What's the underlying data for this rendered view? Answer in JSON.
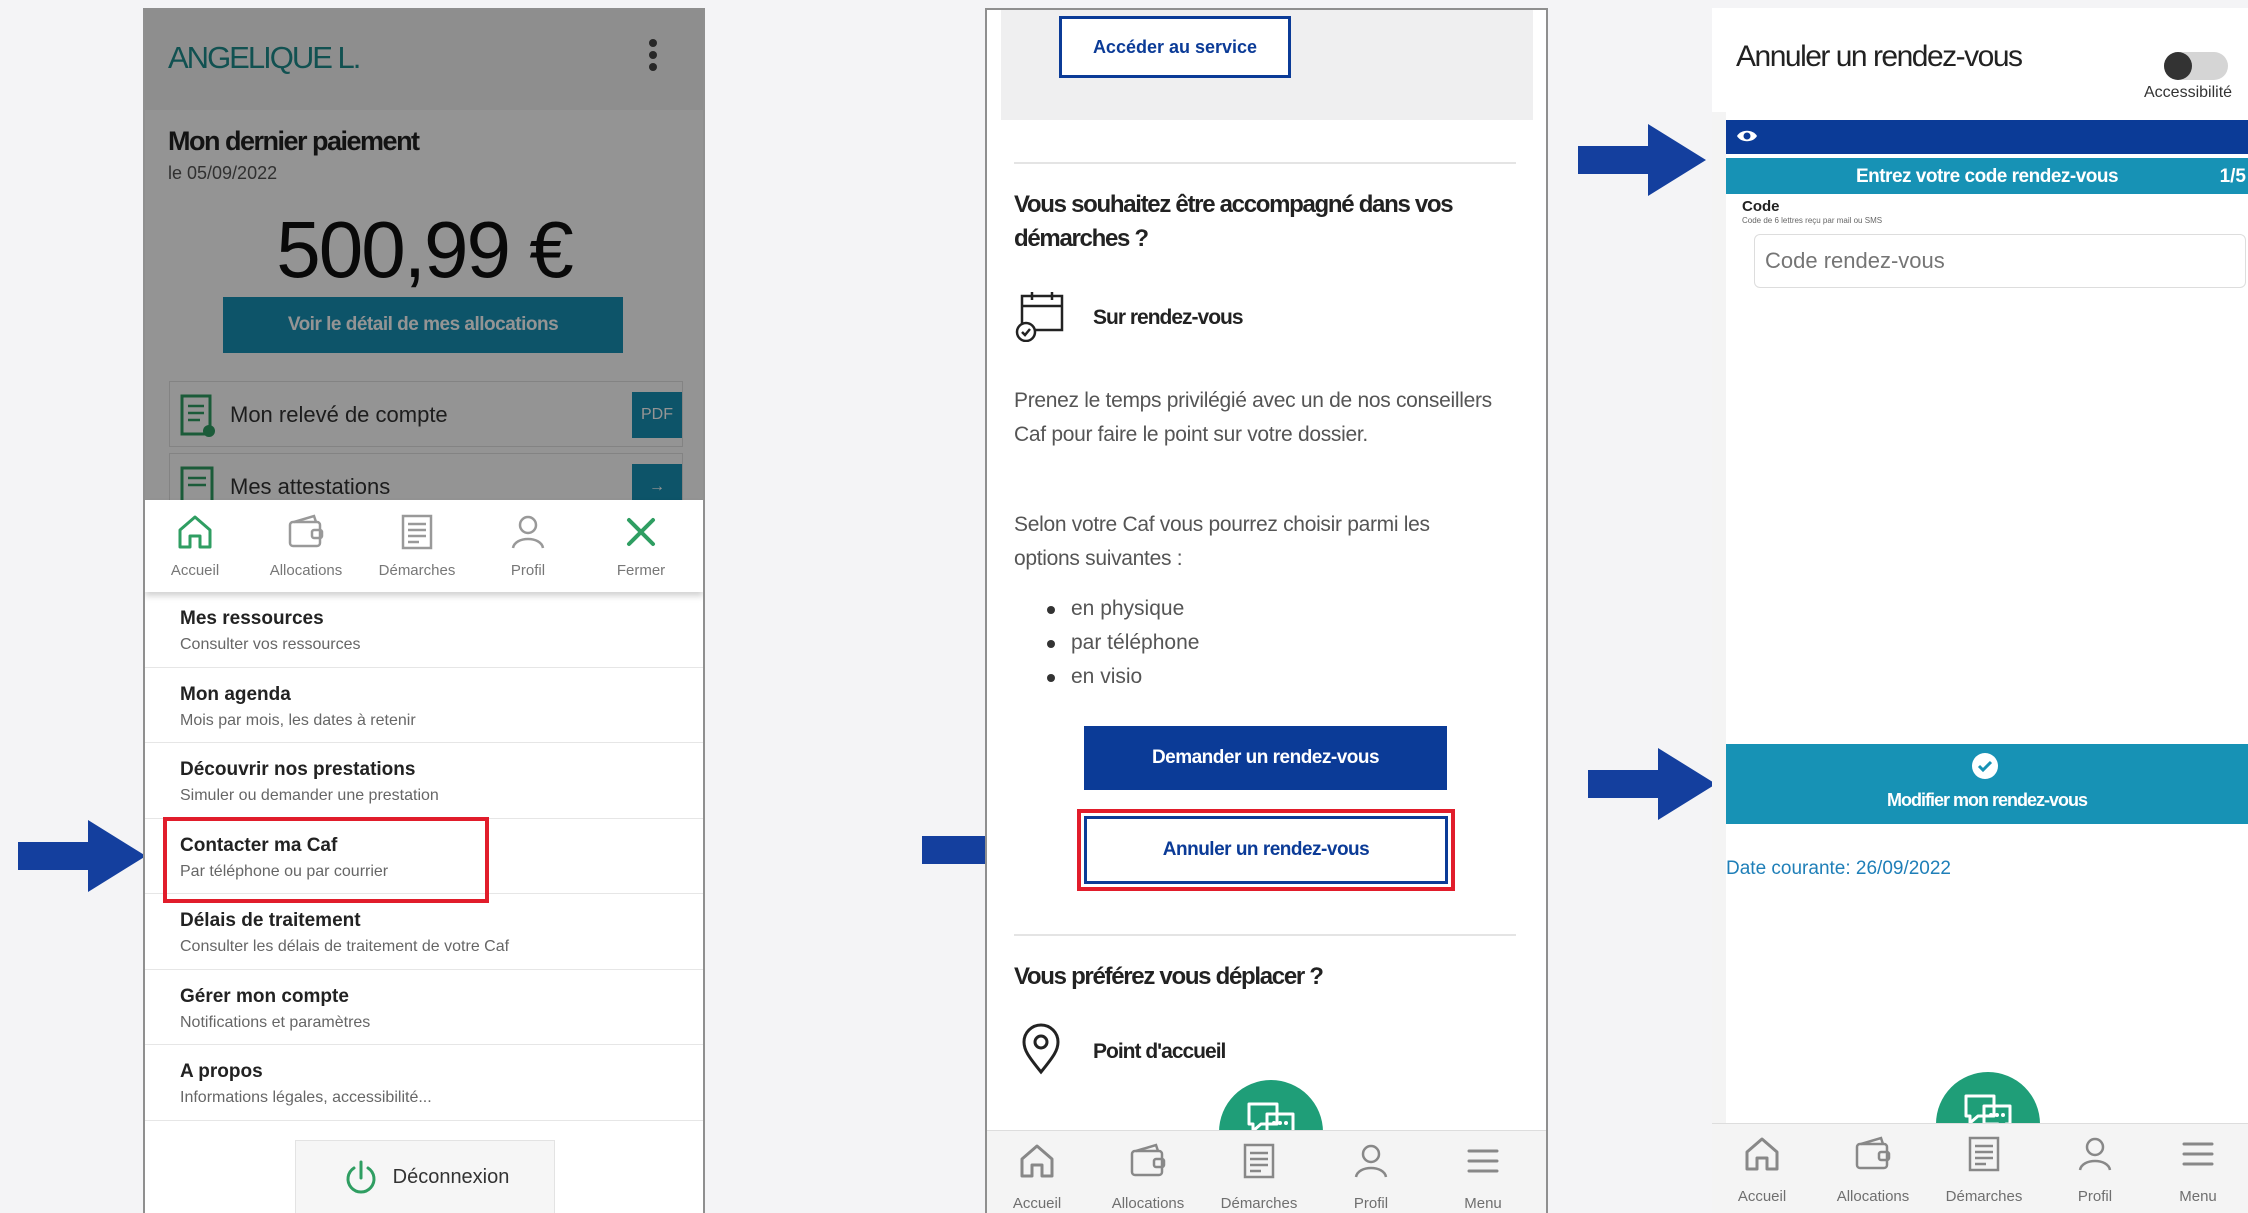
{
  "colors": {
    "teal_button": "#1792b5",
    "navy_button": "#0b3b97",
    "highlight_red": "#e11d2b",
    "arrow_blue": "#143f9e",
    "fab_green": "#1f9e78",
    "user_name_teal": "#1e8c8c"
  },
  "screen1": {
    "user_name": "ANGELIQUE L.",
    "last_payment_title": "Mon dernier paiement",
    "last_payment_date": "le 05/09/2022",
    "amount": "500,99 €",
    "detail_button": "Voir le détail de mes allocations",
    "cards": [
      {
        "label": "Mon relevé de compte",
        "tag": "PDF"
      },
      {
        "label": "Mes attestations",
        "tag": "→"
      }
    ],
    "nav": [
      {
        "label": "Accueil",
        "icon": "home-icon"
      },
      {
        "label": "Allocations",
        "icon": "wallet-icon"
      },
      {
        "label": "Démarches",
        "icon": "document-icon"
      },
      {
        "label": "Profil",
        "icon": "profile-icon"
      },
      {
        "label": "Fermer",
        "icon": "close-icon"
      }
    ],
    "menu": [
      {
        "title": "Mes ressources",
        "subtitle": "Consulter vos ressources"
      },
      {
        "title": "Mon agenda",
        "subtitle": "Mois par mois, les dates à retenir"
      },
      {
        "title": "Découvrir nos prestations",
        "subtitle": "Simuler ou demander une prestation"
      },
      {
        "title": "Contacter ma Caf",
        "subtitle": "Par téléphone ou par courrier"
      },
      {
        "title": "Délais de traitement",
        "subtitle": "Consulter les délais de traitement de votre Caf"
      },
      {
        "title": "Gérer mon compte",
        "subtitle": "Notifications et paramètres"
      },
      {
        "title": "A propos",
        "subtitle": "Informations légales, accessibilité..."
      }
    ],
    "logout": "Déconnexion"
  },
  "screen2": {
    "access_button": "Accéder au service",
    "accompany_heading": "Vous souhaitez être accompagné dans vos démarches ?",
    "appointment_label": "Sur rendez-vous",
    "para1": "Prenez le temps privilégié avec un de nos conseillers Caf pour faire le point sur votre dossier.",
    "para2": "Selon votre Caf vous pourrez choisir parmi les options suivantes :",
    "options": [
      "en physique",
      "par téléphone",
      "en visio"
    ],
    "request_button": "Demander un rendez-vous",
    "cancel_button": "Annuler un rendez-vous",
    "move_heading": "Vous préférez vous déplacer ?",
    "reception_label": "Point d'accueil",
    "nav": [
      {
        "label": "Accueil",
        "icon": "home-icon"
      },
      {
        "label": "Allocations",
        "icon": "wallet-icon"
      },
      {
        "label": "Démarches",
        "icon": "document-icon"
      },
      {
        "label": "Profil",
        "icon": "profile-icon"
      },
      {
        "label": "Menu",
        "icon": "menu-icon"
      }
    ]
  },
  "screen3": {
    "title": "Annuler un rendez-vous",
    "accessibility_label": "Accessibilité",
    "step_title": "Entrez votre code rendez-vous",
    "step_count": "1/5",
    "code_label": "Code",
    "code_hint": "Code de 6 lettres reçu par mail ou SMS",
    "code_placeholder": "Code rendez-vous",
    "modify_button": "Modifier mon rendez-vous",
    "current_date": "Date courante: 26/09/2022",
    "nav": [
      {
        "label": "Accueil",
        "icon": "home-icon"
      },
      {
        "label": "Allocations",
        "icon": "wallet-icon"
      },
      {
        "label": "Démarches",
        "icon": "document-icon"
      },
      {
        "label": "Profil",
        "icon": "profile-icon"
      },
      {
        "label": "Menu",
        "icon": "menu-icon"
      }
    ]
  }
}
